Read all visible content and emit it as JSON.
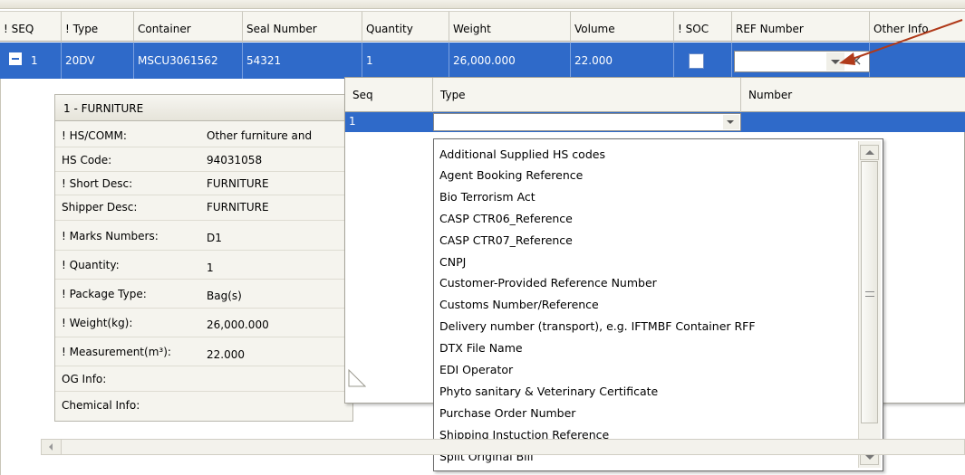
{
  "colors": {
    "selection": "#2f6ac9",
    "arrow": "#b03a1a",
    "header_bg": "#f6f5ef"
  },
  "grid": {
    "columns": [
      "! SEQ",
      "! Type",
      "Container",
      "Seal Number",
      "Quantity",
      "Weight",
      "Volume",
      "! SOC",
      "REF Number",
      "Other Info"
    ],
    "row": {
      "seq": "1",
      "type": "20DV",
      "container": "MSCU3061562",
      "seal": "54321",
      "quantity": "1",
      "weight": "26,000.000",
      "volume": "22.000"
    }
  },
  "detail": {
    "title": "1 - FURNITURE",
    "rows": [
      {
        "label": "! HS/COMM:",
        "value": "Other furniture and"
      },
      {
        "label": "HS Code:",
        "value": "94031058"
      },
      {
        "label": "! Short Desc:",
        "value": "FURNITURE"
      },
      {
        "label": "Shipper Desc:",
        "value": "FURNITURE"
      },
      {
        "label": "! Marks Numbers:",
        "value": "D1"
      },
      {
        "label": "! Quantity:",
        "value": "1"
      },
      {
        "label": "! Package Type:",
        "value": "Bag(s)"
      },
      {
        "label": "! Weight(kg):",
        "value": "26,000.000"
      },
      {
        "label": "! Measurement(m³):",
        "value": "22.000"
      },
      {
        "label": "OG Info:",
        "value": ""
      },
      {
        "label": "Chemical Info:",
        "value": ""
      }
    ]
  },
  "ref_grid": {
    "columns": [
      "Seq",
      "Type",
      "Number"
    ],
    "row": {
      "seq": "1",
      "type": "",
      "number": ""
    }
  },
  "dropdown": {
    "items": [
      "Additional Supplied HS codes",
      "Agent Booking Reference",
      "Bio Terrorism Act",
      "CASP CTR06_Reference",
      "CASP CTR07_Reference",
      "CNPJ",
      "Customer-Provided Reference Number",
      "Customs Number/Reference",
      "Delivery number (transport), e.g. IFTMBF Container RFF",
      "DTX File Name",
      "EDI Operator",
      "Phyto sanitary & Veterinary Certificate",
      "Purchase Order Number",
      "Shipping Instuction Reference",
      "Split Original Bill"
    ]
  }
}
